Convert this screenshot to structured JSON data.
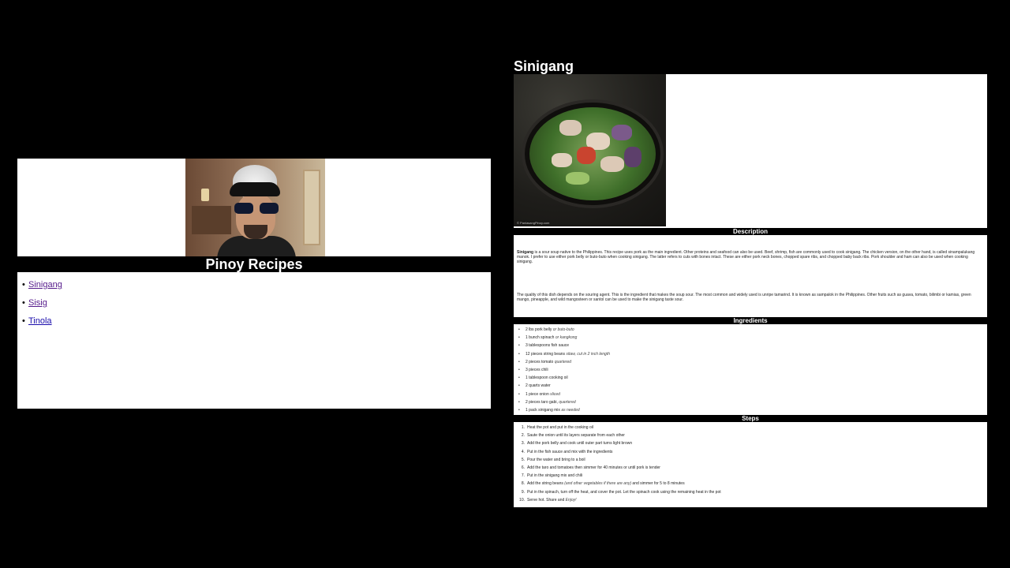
{
  "left": {
    "title": "Pinoy Recipes",
    "links": [
      "Sinigang",
      "Sisig",
      "Tinola"
    ]
  },
  "right": {
    "title": "Sinigang",
    "image_watermark": "© PanlasangPinoy.com",
    "sections": {
      "description": "Description",
      "ingredients": "Ingredients",
      "steps": "Steps"
    },
    "description": [
      {
        "bold": "Sinigang",
        "text": " is a sour soup native to the Philippines. This recipe uses pork as the main ingredient. Other proteins and seafood can also be used. Beef, shrimp, fish are commonly used to cook sinigang. The chicken version, on the other hand, is called sinampalukang manok. I prefer to use either pork belly or buto-buto when cooking sinigang. The latter refers to cuts with bones intact. These are either pork neck bones, chopped spare ribs, and chopped baby back ribs. Pork shoulder and ham can also be used when cooking sinigang."
      },
      {
        "bold": "",
        "text": "The quality of this dish depends on the souring agent. This is the ingredient that makes the soup sour. The most common and widely used is unripe tamarind. It is known as sampalok in the Philippines. Other fruits such as guava, tomato, bilimbi or kamias, green mango, pineapple, and wild mangosteen or santol can be used to make the sinigang taste sour."
      }
    ],
    "ingredients": [
      {
        "main": "2 lbs pork belly ",
        "note": "or buto-buto"
      },
      {
        "main": "1 bunch spinach ",
        "note": "or kangkong"
      },
      {
        "main": "3 tablespoons fish sauce",
        "note": ""
      },
      {
        "main": "12 pieces string beans ",
        "note": "sitaw, cut in 2 inch length"
      },
      {
        "main": "2 pieces tomato ",
        "note": "quartered"
      },
      {
        "main": "3 pieces chili",
        "note": ""
      },
      {
        "main": "1 tablespoon cooking oil",
        "note": ""
      },
      {
        "main": "2 quarts water",
        "note": ""
      },
      {
        "main": "1 piece onion ",
        "note": "sliced"
      },
      {
        "main": "2 pieces taro gabi, ",
        "note": "quartered"
      },
      {
        "main": "1 pack sinigang mix ",
        "note": "as needed"
      }
    ],
    "steps": [
      {
        "n": "1.",
        "text": "Heat the pot and put in the cooking oil",
        "note": "",
        "after": ""
      },
      {
        "n": "2.",
        "text": "Saute the onion until its layers separate from each other",
        "note": "",
        "after": ""
      },
      {
        "n": "3.",
        "text": "Add the pork belly and cook until outer part turns light brown",
        "note": "",
        "after": ""
      },
      {
        "n": "4.",
        "text": "Put in the fish sauce and mix with the ingredients",
        "note": "",
        "after": ""
      },
      {
        "n": "5.",
        "text": "Pour the water and bring to a boil",
        "note": "",
        "after": ""
      },
      {
        "n": "6.",
        "text": "Add the taro and tomatoes then simmer for 40 minutes or until pork is tender",
        "note": "",
        "after": ""
      },
      {
        "n": "7.",
        "text": "Put in the sinigang mix and chili",
        "note": "",
        "after": ""
      },
      {
        "n": "8.",
        "text": "Add the string beans ",
        "note": "(and other vegetables if there are any)",
        "after": " and simmer for 5 to 8 minutes"
      },
      {
        "n": "9.",
        "text": "Put in the spinach, turn off the heat, and cover the pot. Let the spinach cook using the remaining heat in the pot",
        "note": "",
        "after": ""
      },
      {
        "n": "10.",
        "text": "Serve hot. Share and ",
        "note": "Enjoy!",
        "after": ""
      }
    ]
  }
}
